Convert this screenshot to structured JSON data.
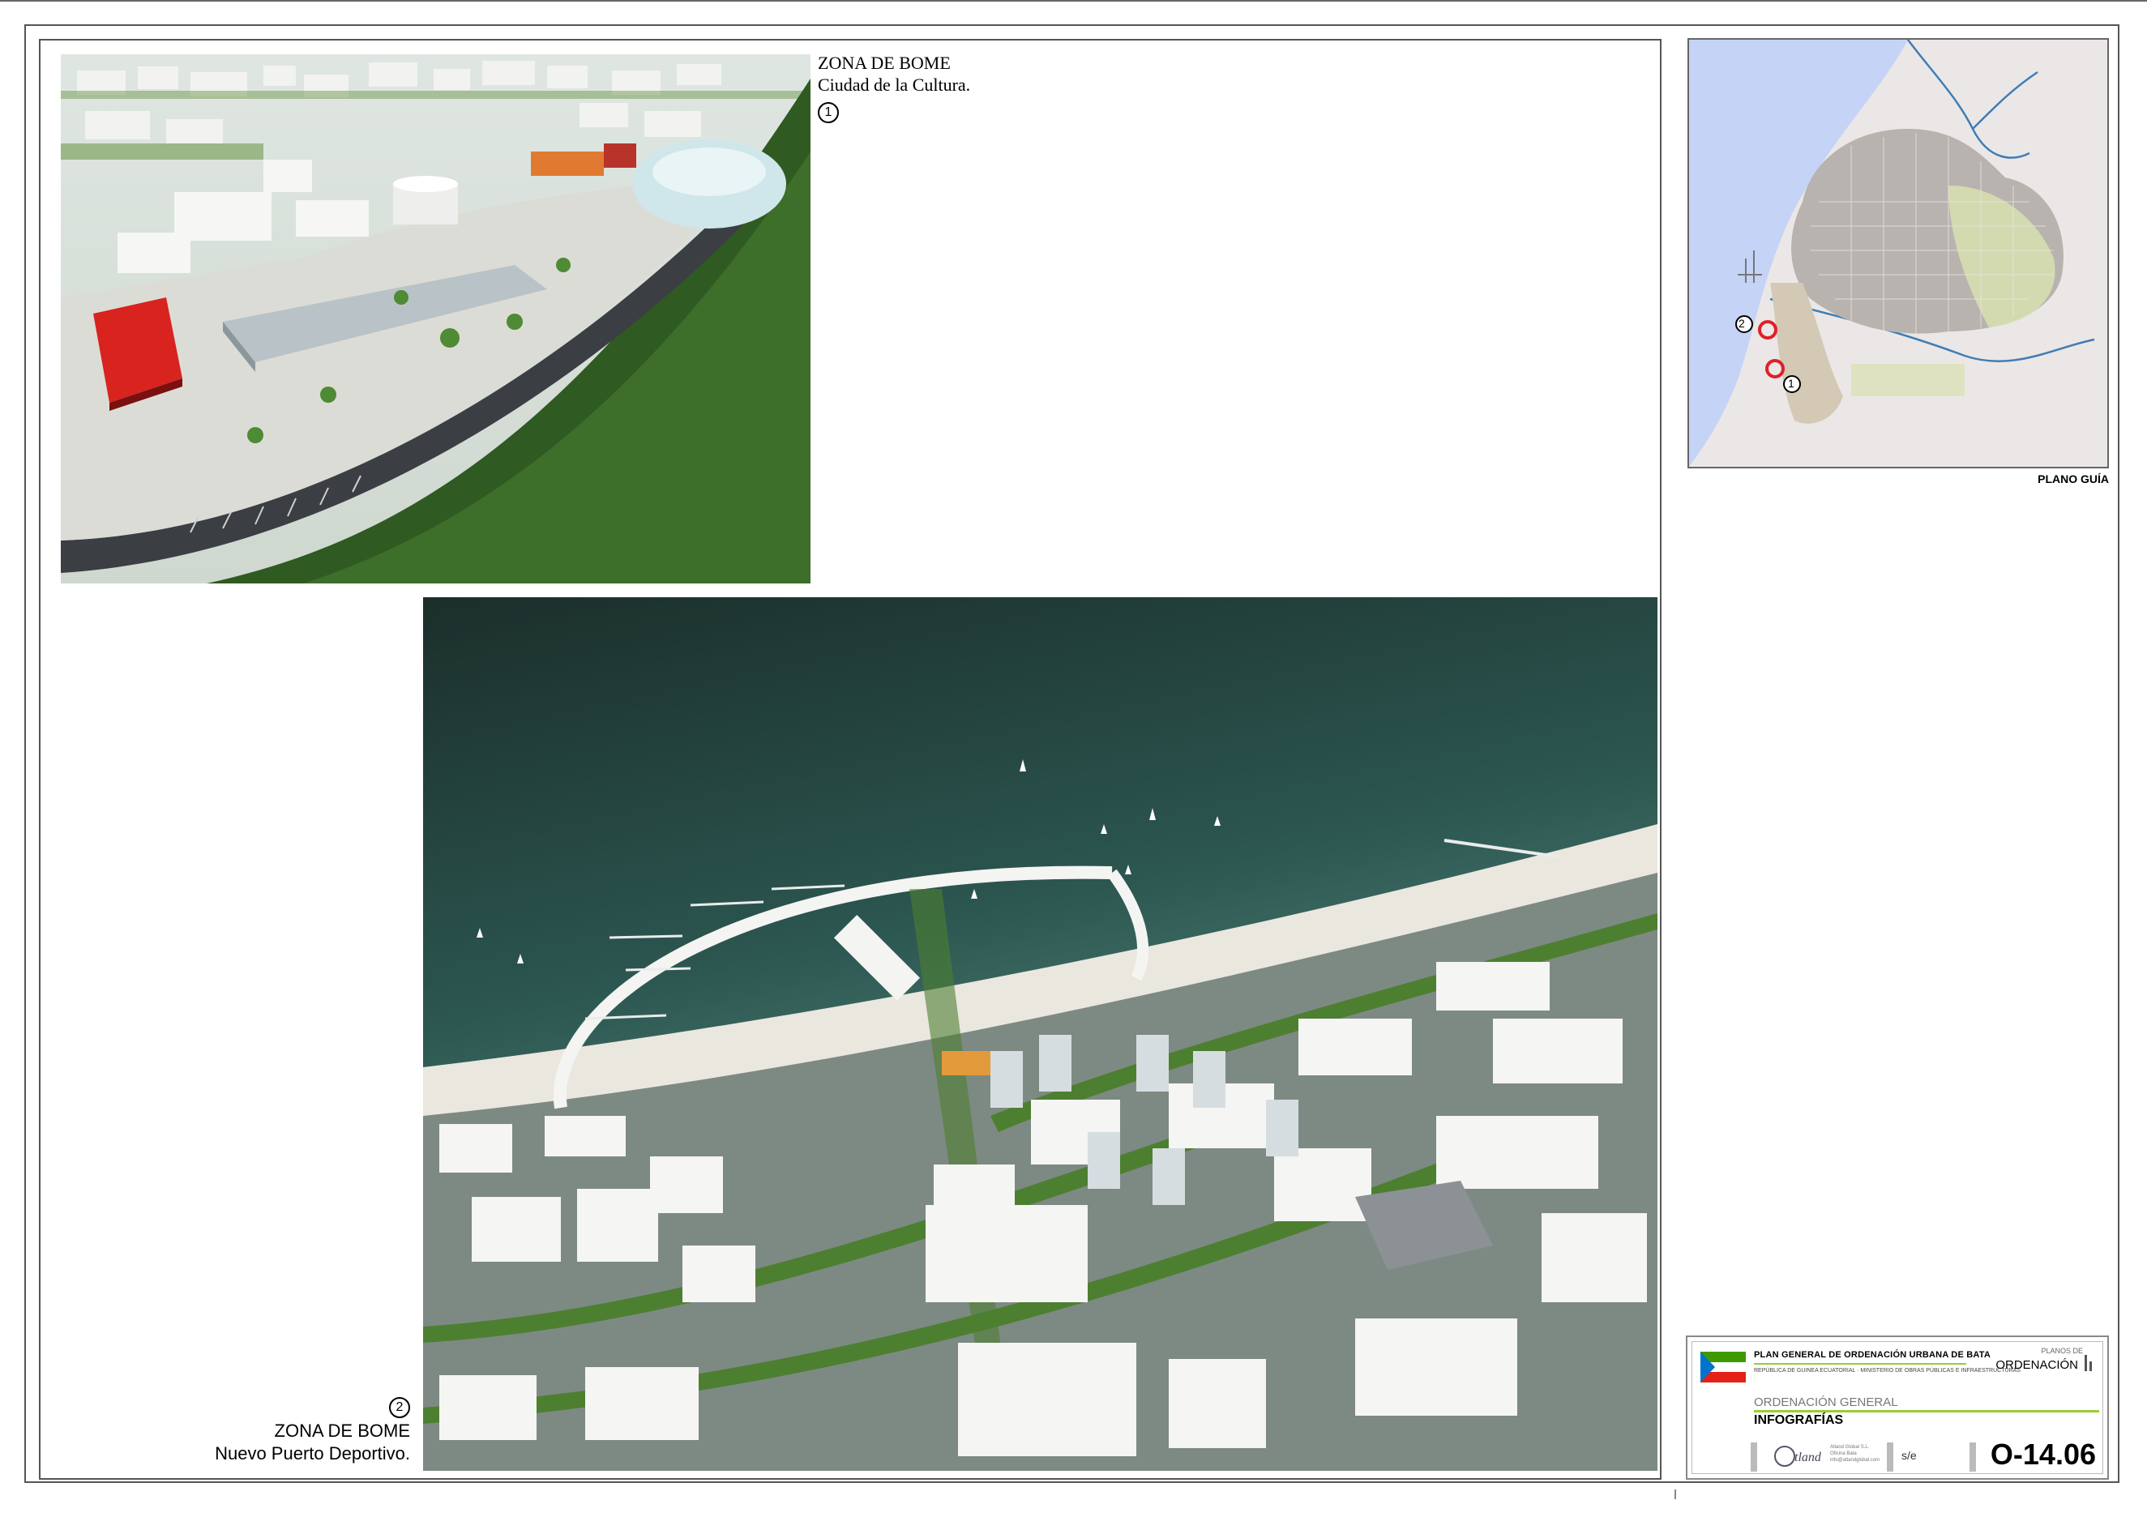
{
  "render1": {
    "caption_title": "ZONA DE BOME",
    "caption_subtitle": "Ciudad de la Cultura.",
    "marker": "1"
  },
  "render2": {
    "caption_title": "ZONA DE BOME",
    "caption_subtitle": "Nuevo Puerto Deportivo.",
    "marker": "2"
  },
  "guide_map": {
    "label": "PLANO GUÍA",
    "marker_1": "1",
    "marker_2": "2",
    "marker_color": "#e0202a",
    "sea_color": "#c5d3f7",
    "land_color": "#ebe7e6"
  },
  "title_block": {
    "project": "PLAN GENERAL DE ORDENACIÓN URBANA DE BATA",
    "subtitle": "REPÚBLICA DE GUINEA ECUATORIAL · MINISTERIO DE OBRAS PÚBLICAS E INFRAESTRUCTURAS",
    "planos_de": "PLANOS DE",
    "ordenacion": "ORDENACIÓN",
    "section": "ORDENACIÓN GENERAL",
    "sheet_title": "INFOGRAFÍAS",
    "company": "Atland Global S.L. Oficina Bata info@atlandglobal.com",
    "scale": "s/e",
    "code": "O-14.06",
    "accent_color": "#9acd32"
  }
}
